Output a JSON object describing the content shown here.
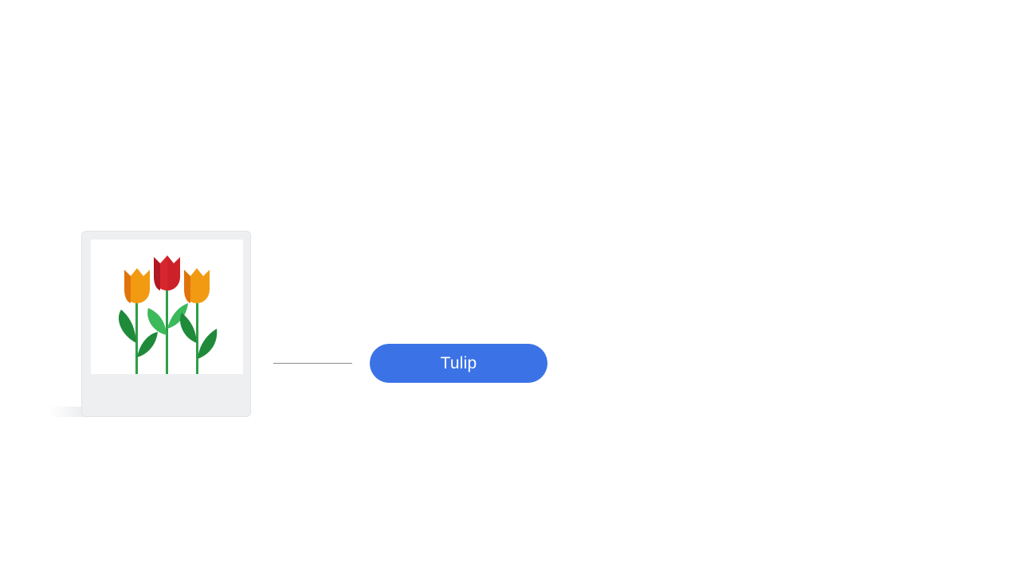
{
  "image": {
    "subject": "tulip-icon",
    "colors": {
      "card_frame": "#eeeff1",
      "stem": "#2e9e48",
      "leaf_dark": "#1f8a3a",
      "leaf_light": "#3cb95a",
      "tulip_orange": "#f29a12",
      "tulip_orange_dark": "#e0740b",
      "tulip_red": "#d8262e",
      "tulip_red_dark": "#b01822"
    }
  },
  "connector": {
    "color": "#8a8d91"
  },
  "label": {
    "text": "Tulip",
    "background": "#3b73e6",
    "text_color": "#ffffff"
  }
}
